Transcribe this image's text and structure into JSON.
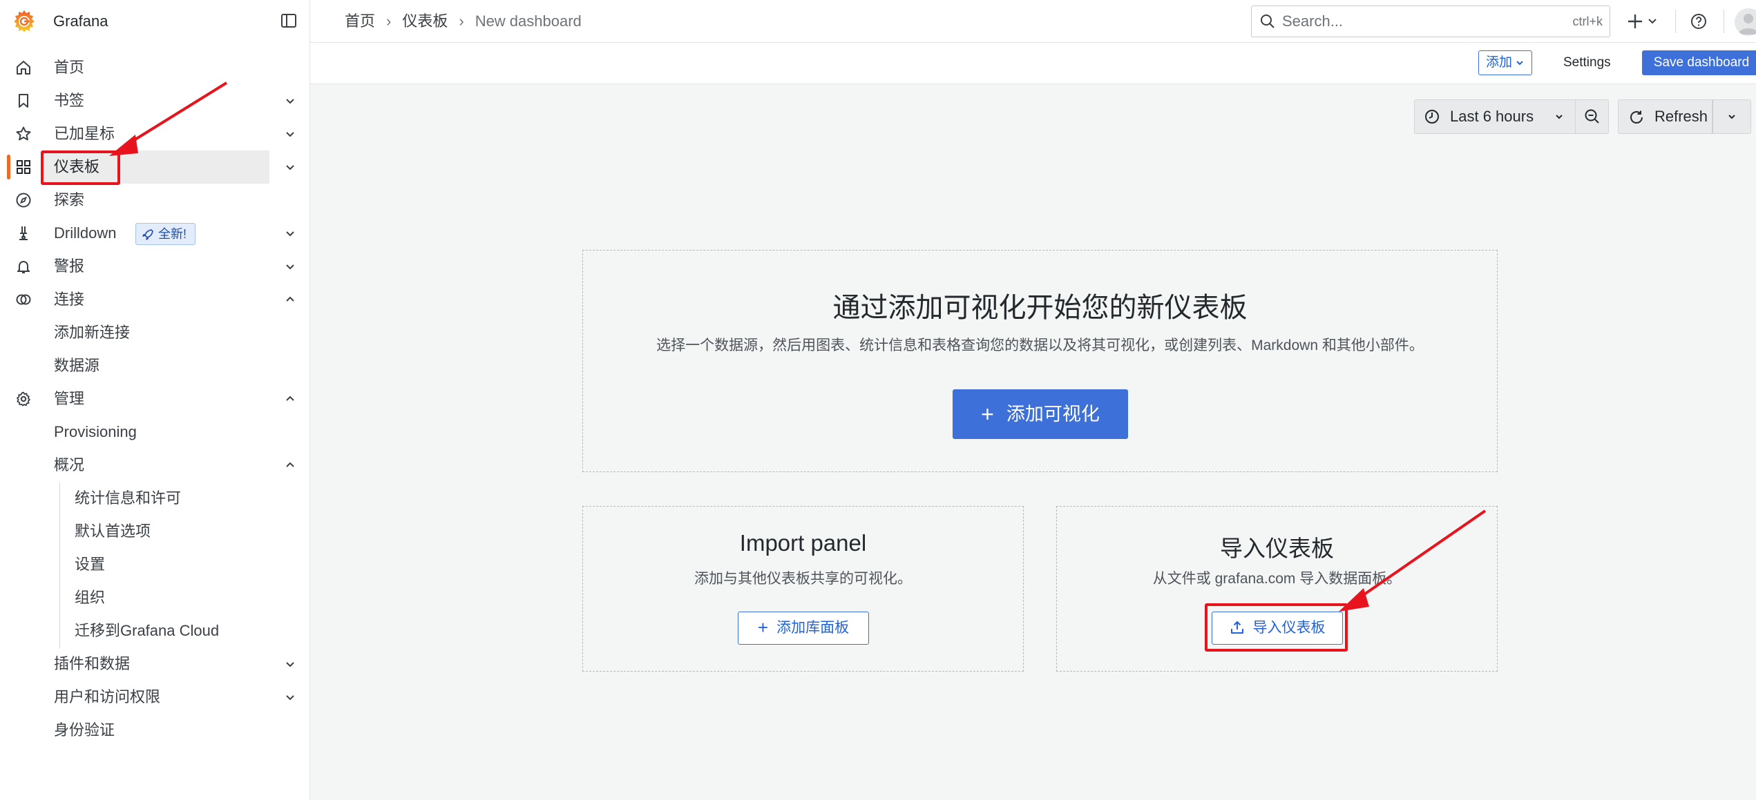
{
  "app": {
    "name": "Grafana"
  },
  "sidebar": {
    "items": [
      {
        "label": "首页",
        "icon": "home-icon",
        "chevron": ""
      },
      {
        "label": "书签",
        "icon": "bookmark-icon",
        "chevron": "down"
      },
      {
        "label": "已加星标",
        "icon": "star-icon",
        "chevron": "down"
      },
      {
        "label": "仪表板",
        "icon": "apps-icon",
        "chevron": "down",
        "active": true
      },
      {
        "label": "探索",
        "icon": "compass-icon",
        "chevron": ""
      },
      {
        "label": "Drilldown",
        "icon": "drilldown-icon",
        "chevron": "down",
        "badge": "全新!"
      },
      {
        "label": "警报",
        "icon": "bell-icon",
        "chevron": "down"
      },
      {
        "label": "连接",
        "icon": "link-icon",
        "chevron": "up"
      },
      {
        "label": "添加新连接",
        "level": 1
      },
      {
        "label": "数据源",
        "level": 1
      },
      {
        "label": "管理",
        "icon": "gear-icon",
        "chevron": "up"
      },
      {
        "label": "Provisioning",
        "level": 1
      },
      {
        "label": "概况",
        "level": 1,
        "chevron": "up"
      },
      {
        "label": "统计信息和许可",
        "level": 2
      },
      {
        "label": "默认首选项",
        "level": 2
      },
      {
        "label": "设置",
        "level": 2
      },
      {
        "label": "组织",
        "level": 2
      },
      {
        "label": "迁移到Grafana Cloud",
        "level": 2
      },
      {
        "label": "插件和数据",
        "level": 1,
        "chevron": "down"
      },
      {
        "label": "用户和访问权限",
        "level": 1,
        "chevron": "down"
      },
      {
        "label": "身份验证",
        "level": 1
      }
    ]
  },
  "breadcrumb": {
    "home": "首页",
    "dashboards": "仪表板",
    "current": "New dashboard",
    "separator": "›"
  },
  "search": {
    "placeholder": "Search...",
    "shortcut": "ctrl+k"
  },
  "toolbar": {
    "add_label": "添加",
    "settings_label": "Settings",
    "save_label": "Save dashboard"
  },
  "time_controls": {
    "range_label": "Last 6 hours",
    "refresh_label": "Refresh"
  },
  "empty_state": {
    "title": "通过添加可视化开始您的新仪表板",
    "description": "选择一个数据源，然后用图表、统计信息和表格查询您的数据以及将其可视化，或创建列表、Markdown 和其他小部件。",
    "add_viz_label": "添加可视化",
    "import_panel": {
      "title": "Import panel",
      "description": "添加与其他仪表板共享的可视化。",
      "button_label": "添加库面板"
    },
    "import_dashboard": {
      "title": "导入仪表板",
      "description": "从文件或 grafana.com 导入数据面板。",
      "button_label": "导入仪表板"
    }
  },
  "colors": {
    "primary": "#3d71d9",
    "annotation": "#e8141d",
    "active_bar": "#f06a24"
  }
}
